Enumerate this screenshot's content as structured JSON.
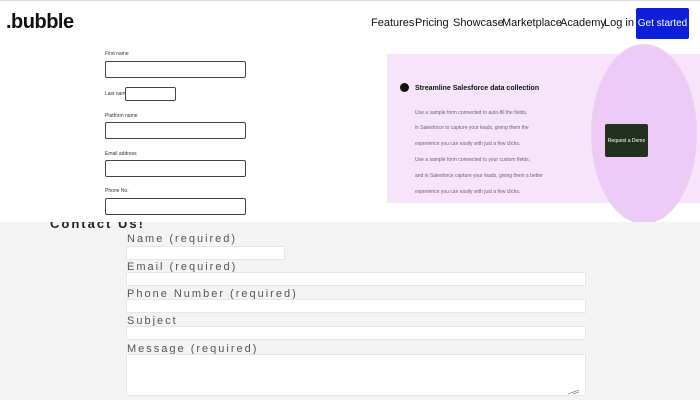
{
  "header": {
    "logo": ".bubble",
    "nav_links": [
      "Features",
      "Pricing",
      "Showcase",
      "Marketplace",
      "Academy"
    ],
    "login": "Log in",
    "cta": "Get started"
  },
  "form_top": {
    "fields": [
      {
        "label": "First name"
      },
      {
        "label": "Last name"
      },
      {
        "label": "Platform name"
      },
      {
        "label": "Email address"
      },
      {
        "label": "Phone No."
      }
    ]
  },
  "banner": {
    "icon": "circle-badge-icon",
    "title": "Streamline Salesforce data collection",
    "body_lines": [
      "Use a sample form connected to auto-fill the fields,",
      "in Salesforce to capture your leads, giving them the",
      "experience you can easily with just a few clicks.",
      "Use a sample form connected to your custom fields,",
      "and in Salesforce capture your leads, giving them a better",
      "experience you can easily with just a few clicks."
    ],
    "demo_button": "Request a Demo"
  },
  "contact_form": {
    "title": "Contact Us!",
    "fields": [
      {
        "label": "Name (required)"
      },
      {
        "label": "Email (required)"
      },
      {
        "label": "Phone Number (required)"
      },
      {
        "label": "Subject"
      },
      {
        "label": "Message (required)"
      }
    ]
  }
}
